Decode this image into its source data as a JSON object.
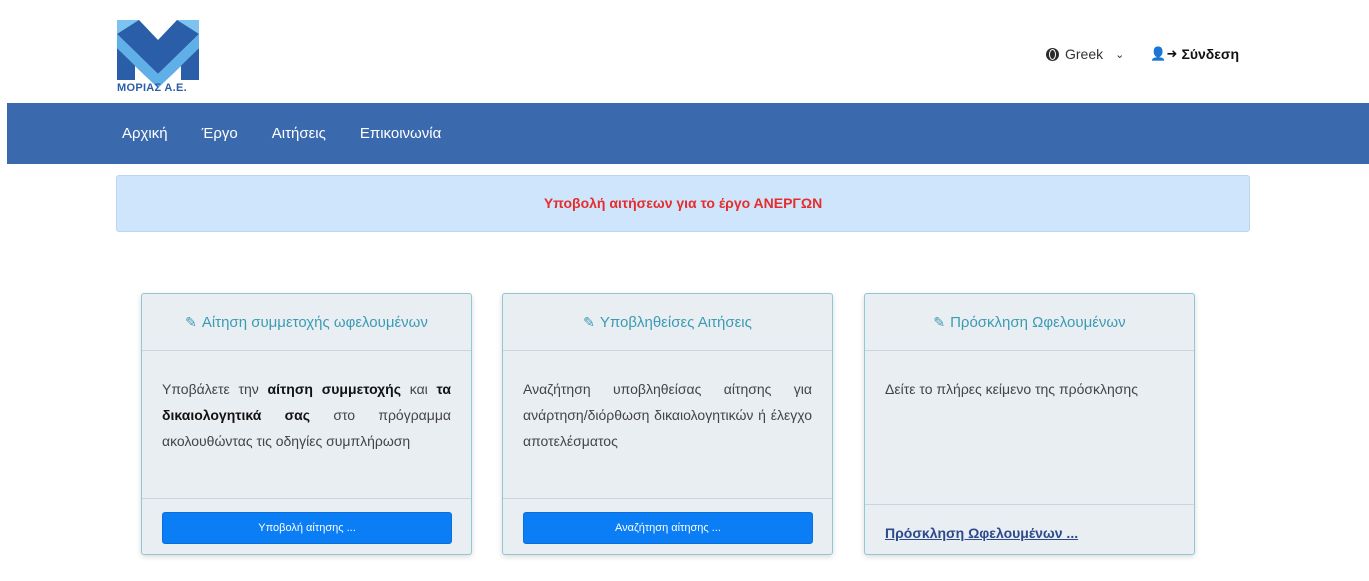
{
  "brand": {
    "logo_text": "ΜΟΡΙΑΣ Α.Ε."
  },
  "header": {
    "language": "Greek",
    "login_label": "Σύνδεση"
  },
  "nav": {
    "items": [
      "Αρχική",
      "Έργο",
      "Αιτήσεις",
      "Επικοινωνία"
    ]
  },
  "alert": {
    "text": "Υποβολή αιτήσεων για το έργο  ΑΝΕΡΓΩΝ"
  },
  "cards": [
    {
      "title": "Αίτηση συμμετοχής ωφελουμένων",
      "body_1": "Υποβάλετε την ",
      "body_bold_1": "αίτηση συμμετοχής",
      "body_2": " και ",
      "body_bold_2": "τα δικαιολογητικά σας",
      "body_3": " στο πρόγραμμα ακολουθώντας τις οδηγίες συμπλήρωση",
      "button": "Υποβολή αίτησης ..."
    },
    {
      "title": "Υποβληθείσες Αιτήσεις",
      "body": "Αναζήτηση υποβληθείσας αίτησης για ανάρτηση/διόρθωση δικαιολογητικών ή έλεγχο αποτελέσματος",
      "button": "Αναζήτηση αίτησης ..."
    },
    {
      "title": "Πρόσκληση Ωφελουμένων",
      "body": "Δείτε το πλήρες κείμενο της πρόσκλησης",
      "link": "Πρόσκληση Ωφελουμένων ..."
    }
  ],
  "colors": {
    "navbar": "#3a6aad",
    "alert_bg": "#cfe5fb",
    "alert_text": "#e52d2d",
    "card_title": "#3b9bb3",
    "button": "#0b7ef6"
  }
}
